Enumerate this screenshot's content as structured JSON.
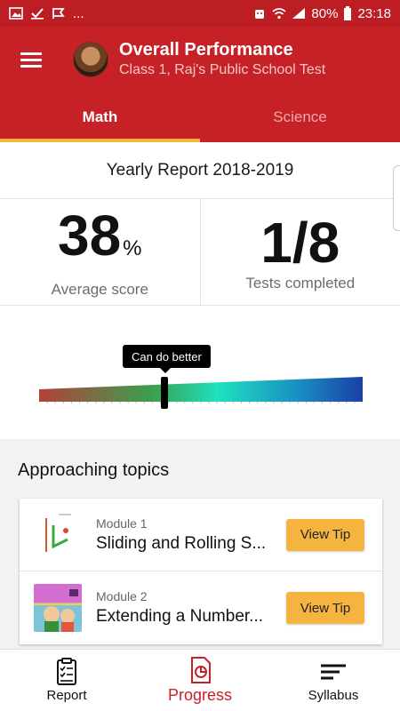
{
  "status_bar": {
    "battery": "80%",
    "time": "23:18",
    "more": "..."
  },
  "header": {
    "title": "Overall Performance",
    "subtitle": "Class 1, Raj's Public School Test"
  },
  "tabs": [
    {
      "label": "Math",
      "active": true
    },
    {
      "label": "Science",
      "active": false
    }
  ],
  "report": {
    "title": "Yearly Report 2018-2019",
    "average_score": {
      "value": "38",
      "unit": "%",
      "label": "Average score"
    },
    "tests_completed": {
      "value": "1/8",
      "label": "Tests completed"
    },
    "gauge": {
      "tooltip": "Can do better",
      "level": 0.38
    }
  },
  "topics": {
    "heading": "Approaching topics",
    "items": [
      {
        "module": "Module 1",
        "name": "Sliding and Rolling S...",
        "button": "View Tip"
      },
      {
        "module": "Module 2",
        "name": "Extending a Number...",
        "button": "View Tip"
      }
    ]
  },
  "bottom_nav": [
    {
      "label": "Report",
      "icon": "clipboard-checklist-icon",
      "active": false
    },
    {
      "label": "Progress",
      "icon": "progress-chart-icon",
      "active": true
    },
    {
      "label": "Syllabus",
      "icon": "syllabus-lines-icon",
      "active": false
    }
  ],
  "colors": {
    "primary": "#c62127",
    "accent": "#f4b43f"
  }
}
